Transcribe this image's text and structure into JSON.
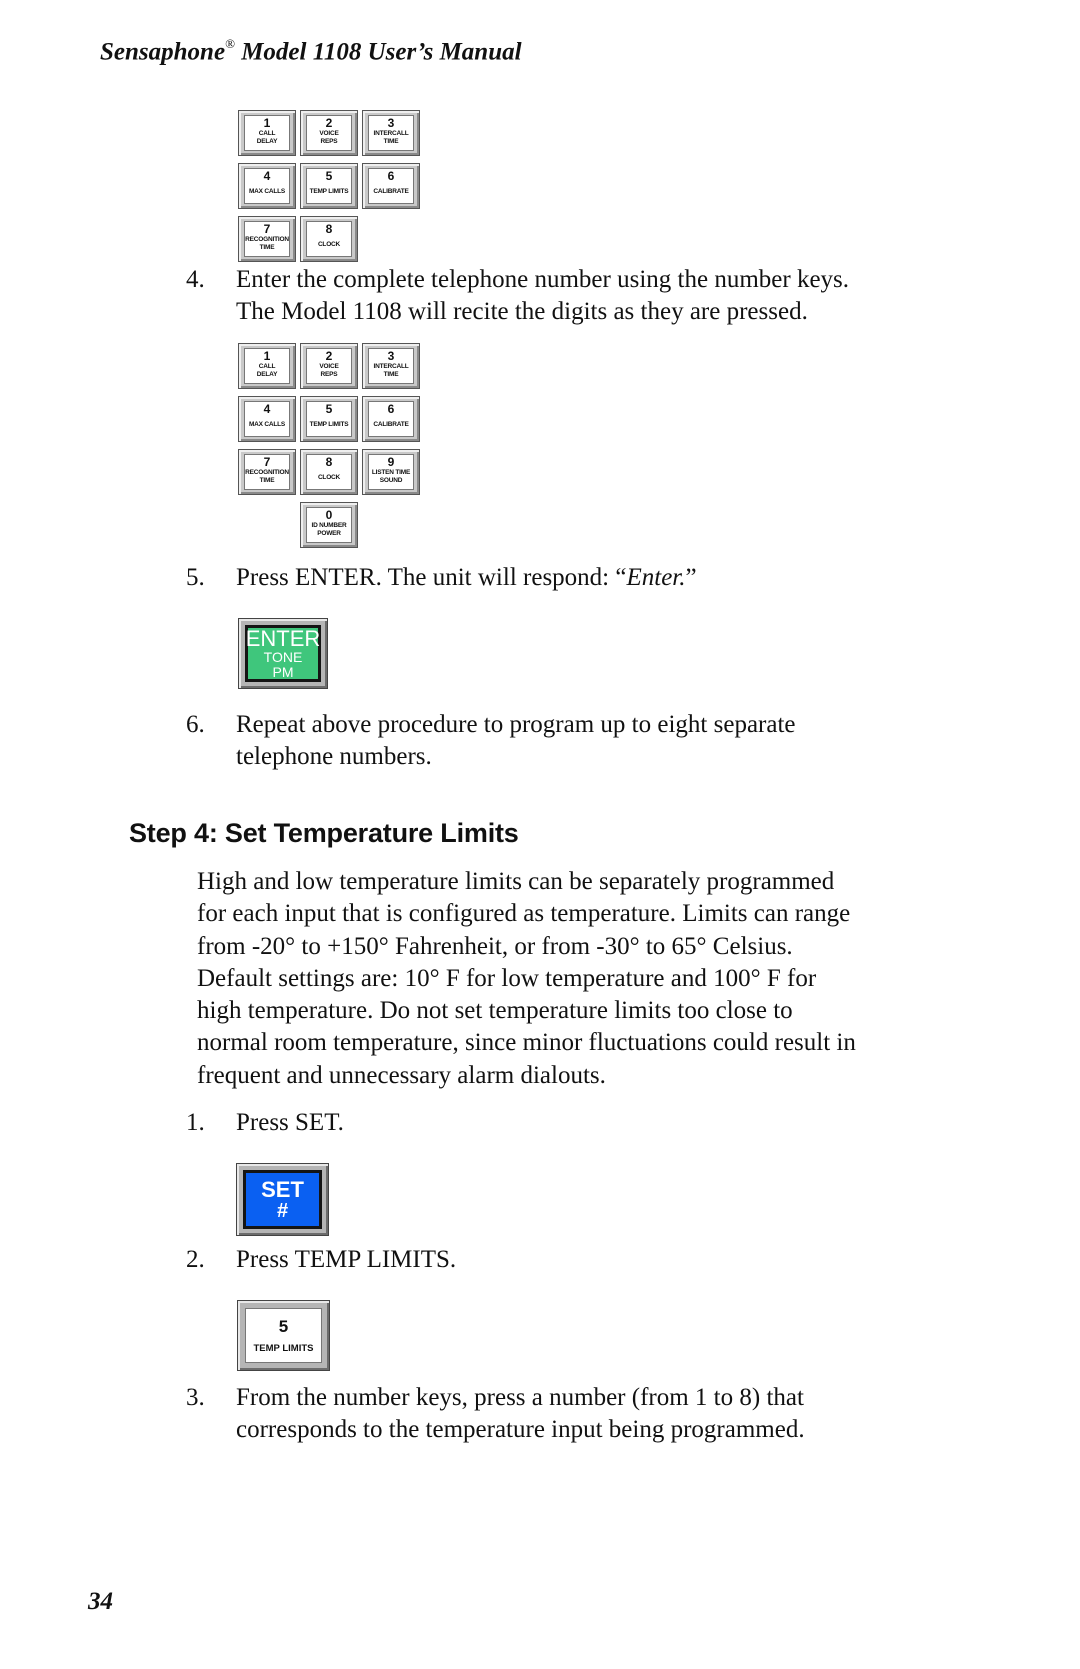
{
  "header": {
    "brand": "Sensaphone",
    "registered_mark": "®",
    "title_rest": " Model 1108 User’s Manual"
  },
  "keypad_1": {
    "keys": [
      {
        "digit": "1",
        "label1": "CALL",
        "label2": "DELAY"
      },
      {
        "digit": "2",
        "label1": "VOICE",
        "label2": "REPS"
      },
      {
        "digit": "3",
        "label1": "INTERCALL",
        "label2": "TIME"
      },
      {
        "digit": "4",
        "label1": "MAX CALLS",
        "label2": ""
      },
      {
        "digit": "5",
        "label1": "TEMP LIMITS",
        "label2": ""
      },
      {
        "digit": "6",
        "label1": "CALIBRATE",
        "label2": ""
      },
      {
        "digit": "7",
        "label1": "RECOGNITION",
        "label2": "TIME"
      },
      {
        "digit": "8",
        "label1": "CLOCK",
        "label2": ""
      }
    ]
  },
  "step4_item": {
    "number": "4.",
    "lines": [
      "Enter the complete telephone number using the number keys.",
      "The Model 1108 will recite the digits as they are pressed."
    ]
  },
  "keypad_2": {
    "keys": [
      {
        "digit": "1",
        "label1": "CALL",
        "label2": "DELAY"
      },
      {
        "digit": "2",
        "label1": "VOICE",
        "label2": "REPS"
      },
      {
        "digit": "3",
        "label1": "INTERCALL",
        "label2": "TIME"
      },
      {
        "digit": "4",
        "label1": "MAX CALLS",
        "label2": ""
      },
      {
        "digit": "5",
        "label1": "TEMP LIMITS",
        "label2": ""
      },
      {
        "digit": "6",
        "label1": "CALIBRATE",
        "label2": ""
      },
      {
        "digit": "7",
        "label1": "RECOGNITION",
        "label2": "TIME"
      },
      {
        "digit": "8",
        "label1": "CLOCK",
        "label2": ""
      },
      {
        "digit": "9",
        "label1": "LISTEN TIME",
        "label2": "SOUND"
      },
      {
        "digit": "0",
        "label1": "ID NUMBER",
        "label2": "POWER"
      }
    ]
  },
  "step5_item": {
    "number": "5.",
    "text_before": "Press ENTER. The unit will respond: ",
    "quote_open": "“",
    "response": "Enter.",
    "quote_close": "”"
  },
  "enter_button": {
    "line1": "ENTER",
    "line2": "TONE",
    "line3": "PM",
    "color": "#3fc67c"
  },
  "step6_item": {
    "number": "6.",
    "lines": [
      "Repeat above procedure to program up to eight separate",
      "telephone numbers."
    ]
  },
  "section": {
    "heading": "Step 4:  Set Temperature Limits",
    "paragraph_lines": [
      "High and low temperature limits can be separately programmed",
      "for each input that is configured as temperature. Limits can range",
      "from -20°  to +150° Fahrenheit, or from -30°  to 65° Celsius.",
      "Default settings are: 10° F for low temperature and 100° F for",
      "high temperature. Do not set temperature limits too close to",
      "normal room temperature, since minor fluctuations could result in",
      "frequent and unnecessary alarm dialouts."
    ],
    "items": [
      {
        "number": "1.",
        "lines": [
          "Press SET."
        ]
      },
      {
        "number": "2.",
        "lines": [
          "Press TEMP LIMITS."
        ]
      },
      {
        "number": "3.",
        "lines": [
          "From the number keys, press a number (from 1 to 8) that",
          "corresponds to the temperature input being programmed."
        ]
      }
    ]
  },
  "set_button": {
    "line1": "SET",
    "line2": "#",
    "color": "#0a60f2"
  },
  "temp_limits_key": {
    "digit": "5",
    "label": "TEMP LIMITS"
  },
  "page_number": "34"
}
